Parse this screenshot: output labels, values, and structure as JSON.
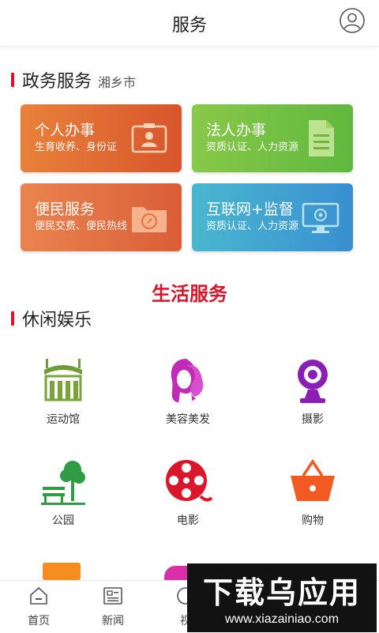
{
  "header": {
    "title": "服务"
  },
  "gov": {
    "title": "政务服务",
    "city": "湘乡市",
    "cards": [
      {
        "title": "个人办事",
        "desc": "生育收养、身份证",
        "icon": "id-card-icon"
      },
      {
        "title": "法人办事",
        "desc": "资质认证、人力资源",
        "icon": "document-icon"
      },
      {
        "title": "便民服务",
        "desc": "便民交费、便民热线",
        "icon": "folder-compass-icon"
      },
      {
        "title": "互联网+监督",
        "desc": "资质认证、人力资源",
        "icon": "monitor-icon"
      }
    ]
  },
  "life": {
    "title": "生活服务",
    "section": "休闲娱乐",
    "items": [
      {
        "label": "运动馆",
        "icon": "stadium-icon",
        "color": "#7aa33a"
      },
      {
        "label": "美容美发",
        "icon": "hair-salon-icon",
        "color": "#c22ab8"
      },
      {
        "label": "摄影",
        "icon": "camera-icon",
        "color": "#8a1fb5"
      },
      {
        "label": "公园",
        "icon": "park-icon",
        "color": "#2e9d43"
      },
      {
        "label": "电影",
        "icon": "film-reel-icon",
        "color": "#d9162a"
      },
      {
        "label": "购物",
        "icon": "shopping-basket-icon",
        "color": "#f25a22"
      }
    ]
  },
  "tabs": [
    {
      "label": "首页",
      "icon": "home-icon"
    },
    {
      "label": "新闻",
      "icon": "news-icon"
    },
    {
      "label": "视",
      "icon": "video-icon"
    }
  ],
  "watermark": {
    "text": "下载乌应用",
    "url": "www.xiazainiao.com"
  },
  "colors": {
    "accent": "#e0102a",
    "life_title": "#d9162a"
  }
}
